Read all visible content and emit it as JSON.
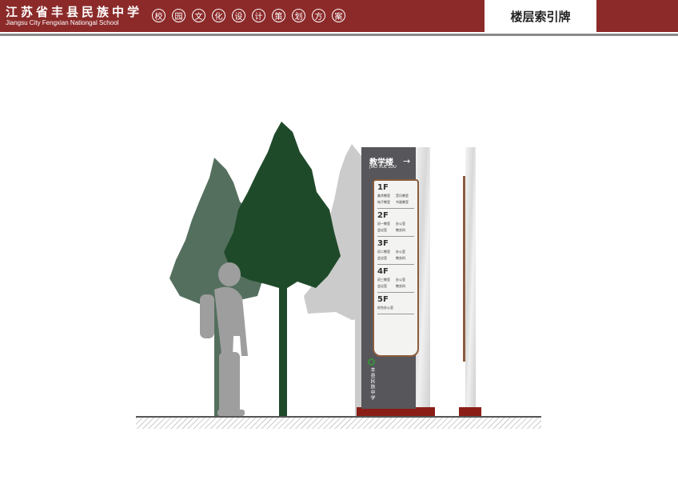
{
  "header": {
    "school_cn": "江苏省丰县民族中学",
    "school_en": "Jiangsu City Fengxian Nationgal School",
    "plan_chars": [
      "校",
      "园",
      "文",
      "化",
      "设",
      "计",
      "策",
      "划",
      "方",
      "案"
    ],
    "page_title": "楼层索引牌"
  },
  "sign": {
    "title": "教学楼",
    "pinyin": "JIAO XUE LOU",
    "arrow": "→",
    "floors": [
      {
        "label": "1F",
        "rooms": [
          "美术教室",
          "音乐教室",
          "电子教室",
          "书画教室"
        ]
      },
      {
        "label": "2F",
        "rooms": [
          "初一教室",
          "办公室",
          "会议室",
          "教务科"
        ]
      },
      {
        "label": "3F",
        "rooms": [
          "初二教室",
          "办公室",
          "会议室",
          "教务科"
        ]
      },
      {
        "label": "4F",
        "rooms": [
          "初三教室",
          "办公室",
          "会议室",
          "教务科"
        ]
      },
      {
        "label": "5F",
        "rooms": [
          "综合办公室"
        ]
      }
    ],
    "school_vertical": "丰县民族中学"
  },
  "colors": {
    "brand_red": "#8c2a2a",
    "sign_gray": "#56565b",
    "frame_brown": "#8b5c3e",
    "tree_dark": "#1f4a2a",
    "tree_sage": "#536f5d",
    "tree_light": "#c9c9c9",
    "person": "#9e9e9e",
    "base_red": "#8a1d16"
  }
}
